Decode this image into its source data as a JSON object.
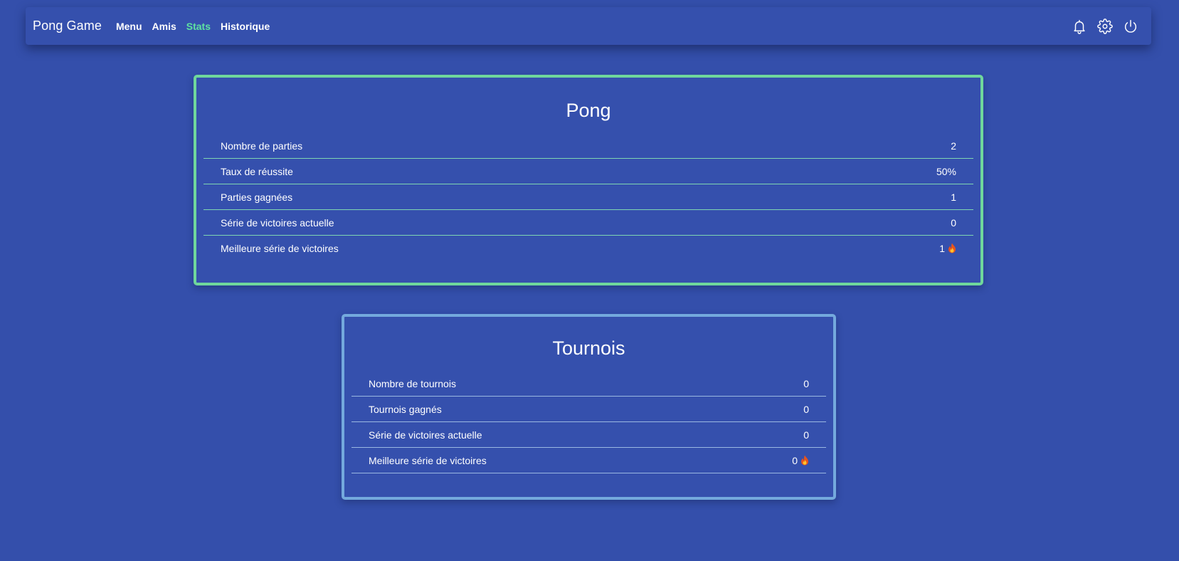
{
  "navbar": {
    "brand": "Pong Game",
    "links": [
      {
        "label": "Menu",
        "active": false
      },
      {
        "label": "Amis",
        "active": false
      },
      {
        "label": "Stats",
        "active": true
      },
      {
        "label": "Historique",
        "active": false
      }
    ],
    "icons": [
      "bell-icon",
      "gear-icon",
      "power-icon"
    ],
    "active_color": "#5ee3a0"
  },
  "pong": {
    "title": "Pong",
    "border_color": "#6fd79c",
    "rows": [
      {
        "label": "Nombre de parties",
        "value": "2"
      },
      {
        "label": "Taux de réussite",
        "value": "50%"
      },
      {
        "label": "Parties gagnées",
        "value": "1"
      },
      {
        "label": "Série de victoires actuelle",
        "value": "0"
      },
      {
        "label": "Meilleure série de victoires",
        "value": "1",
        "icon": "fire-icon"
      }
    ]
  },
  "tournois": {
    "title": "Tournois",
    "border_color": "#74a9dd",
    "rows": [
      {
        "label": "Nombre de tournois",
        "value": "0"
      },
      {
        "label": "Tournois gagnés",
        "value": "0"
      },
      {
        "label": "Série de victoires actuelle",
        "value": "0"
      },
      {
        "label": "Meilleure série de victoires",
        "value": "0",
        "icon": "fire-icon"
      }
    ]
  },
  "colors": {
    "background": "#344fab"
  }
}
